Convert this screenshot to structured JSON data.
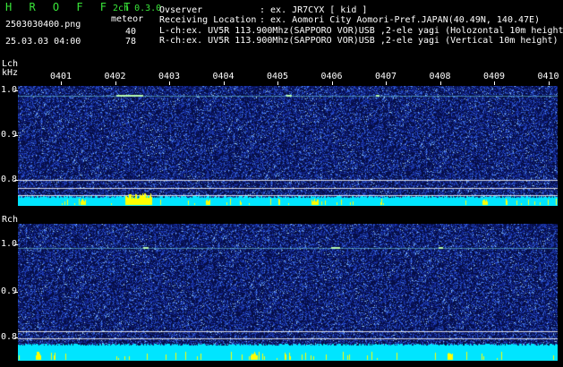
{
  "header": {
    "title": "H R O F F T",
    "mode": "2ch 0.3.0",
    "file": "2503030400.png",
    "kind": "meteor",
    "datetime": "25.03.03 04:00",
    "lch_count": "40",
    "rch_count": "78",
    "observer_label": "Ovserver",
    "observer_value": ": ex. JR7CYX [ kid ]",
    "location_label": "Receiving Location",
    "location_value": ": ex. Aomori City Aomori-Pref.JAPAN(40.49N, 140.47E)",
    "lch_line": "L-ch:ex. UV5R 113.900Mhz(SAPPORO VOR)USB ,2-ele yagi (Holozontal 10m height)",
    "rch_line": "R-ch:ex. UV5R 113.900Mhz(SAPPORO VOR)USB ,2-ele yagi (Vertical 10m height)"
  },
  "lch": {
    "label": "Lch",
    "unit": "kHz",
    "yticks": [
      "1.0",
      "0.9",
      "0.8"
    ]
  },
  "rch": {
    "label": "Rch",
    "yticks": [
      "1.0",
      "0.9",
      "0.8"
    ]
  },
  "time_axis": {
    "ticks": [
      "0401",
      "0402",
      "0403",
      "0404",
      "0405",
      "0406",
      "0407",
      "0408",
      "0409",
      "0410"
    ]
  },
  "colors": {
    "background": "#000000",
    "spectrogram_base": "#08124a",
    "noise_floor": "#00e5ff",
    "meteor": "#ffff00",
    "title_green": "#39e639"
  }
}
